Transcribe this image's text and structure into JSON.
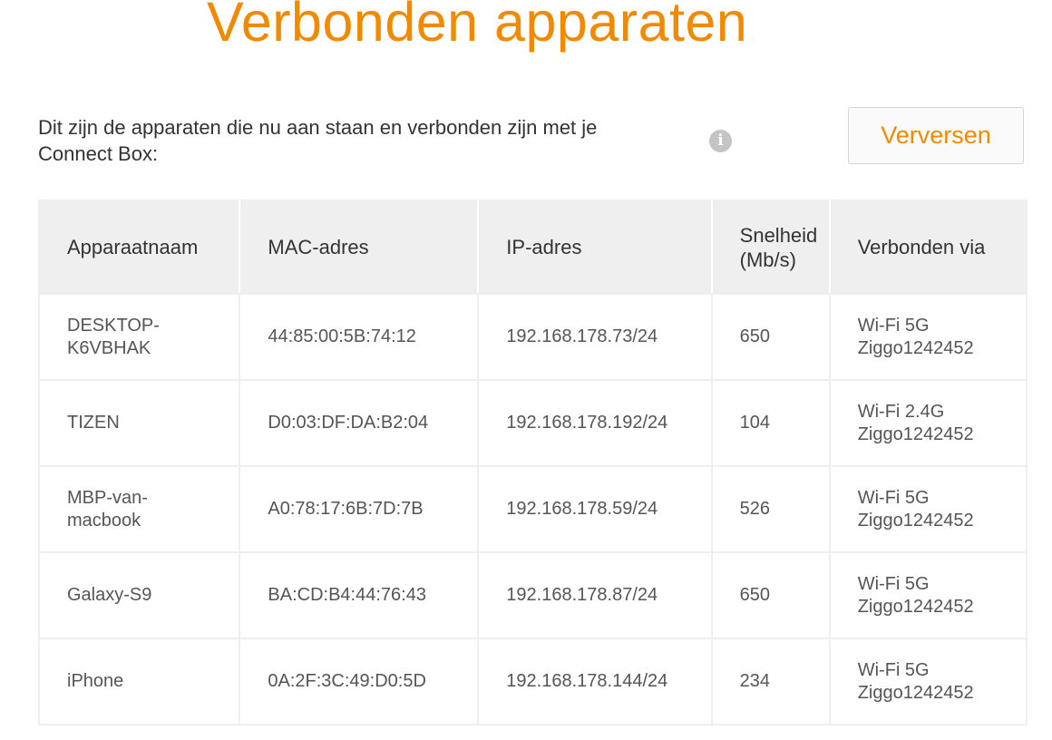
{
  "page": {
    "title": "Verbonden apparaten",
    "intro_line1": "Dit zijn de apparaten die nu aan staan en verbonden zijn met je",
    "intro_line2": "Connect Box:",
    "info_icon": "info-icon",
    "refresh_label": "Verversen"
  },
  "colors": {
    "accent": "#f18a00",
    "header_bg": "#efefef",
    "info_icon": "#c4c4c4"
  },
  "table": {
    "headers": {
      "name": "Apparaatnaam",
      "mac": "MAC-adres",
      "ip": "IP-adres",
      "speed_line1": "Snelheid",
      "speed_line2": "(Mb/s)",
      "via": "Verbonden via"
    },
    "rows": [
      {
        "name1": "DESKTOP-",
        "name2": "K6VBHAK",
        "mac": "44:85:00:5B:74:12",
        "ip": "192.168.178.73/24",
        "speed": "650",
        "via1": "Wi-Fi 5G",
        "via2": "Ziggo1242452"
      },
      {
        "name1": "TIZEN",
        "name2": "",
        "mac": "D0:03:DF:DA:B2:04",
        "ip": "192.168.178.192/24",
        "speed": "104",
        "via1": "Wi-Fi 2.4G",
        "via2": "Ziggo1242452"
      },
      {
        "name1": "MBP-van-",
        "name2": "macbook",
        "mac": "A0:78:17:6B:7D:7B",
        "ip": "192.168.178.59/24",
        "speed": "526",
        "via1": "Wi-Fi 5G",
        "via2": "Ziggo1242452"
      },
      {
        "name1": "Galaxy-S9",
        "name2": "",
        "mac": "BA:CD:B4:44:76:43",
        "ip": "192.168.178.87/24",
        "speed": "650",
        "via1": "Wi-Fi 5G",
        "via2": "Ziggo1242452"
      },
      {
        "name1": "iPhone",
        "name2": "",
        "mac": "0A:2F:3C:49:D0:5D",
        "ip": "192.168.178.144/24",
        "speed": "234",
        "via1": "Wi-Fi 5G",
        "via2": "Ziggo1242452"
      }
    ]
  }
}
